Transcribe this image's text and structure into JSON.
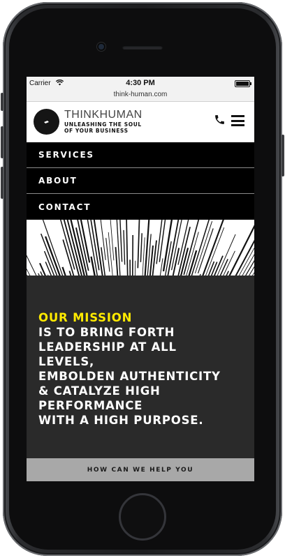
{
  "status_bar": {
    "carrier": "Carrier",
    "wifi_icon": "wifi-icon",
    "time": "4:30 PM",
    "battery_icon": "battery-icon",
    "battery_level": 1.0
  },
  "browser": {
    "url": "think-human.com"
  },
  "header": {
    "logo_icon": "lightning-bolt-icon",
    "brand_name": "THINKHUMAN",
    "tagline": "UNLEASHING THE SOUL OF YOUR BUSINESS",
    "phone_icon": "phone-icon",
    "menu_icon": "hamburger-menu-icon"
  },
  "nav": {
    "items": [
      {
        "label": "SERVICES"
      },
      {
        "label": "ABOUT"
      },
      {
        "label": "CONTACT"
      }
    ]
  },
  "mission": {
    "title": "OUR MISSION",
    "body": "IS TO BRING FORTH\nLEADERSHIP AT ALL\nLEVELS,\nEMBOLDEN AUTHENTICITY\n& CATALYZE HIGH\nPERFORMANCE\nWITH A HIGH PURPOSE."
  },
  "cta": {
    "label": "HOW CAN WE HELP YOU"
  },
  "colors": {
    "accent": "#ffea00",
    "nav_bg": "#000000",
    "hero_bg": "#2a2a2a",
    "cta_bg": "#a8a8a8"
  }
}
